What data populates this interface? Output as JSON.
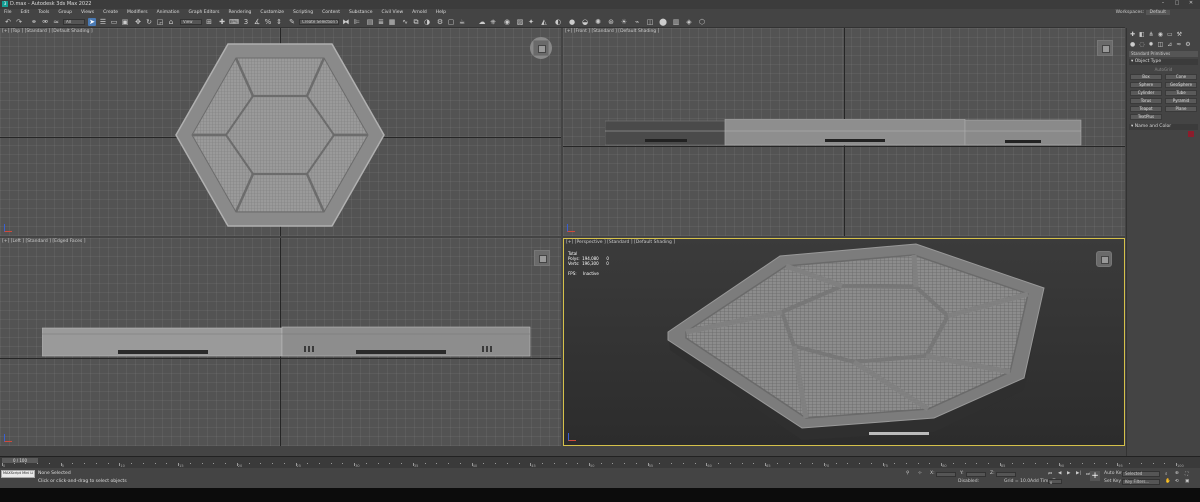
{
  "window": {
    "title": "D.max - Autodesk 3ds Max 2022",
    "controls": [
      "–",
      "□",
      "✕"
    ]
  },
  "menu": {
    "items": [
      "File",
      "Edit",
      "Tools",
      "Group",
      "Views",
      "Create",
      "Modifiers",
      "Animation",
      "Graph Editors",
      "Rendering",
      "Customize",
      "Scripting",
      "Content",
      "Substance",
      "Civil View",
      "Arnold",
      "Help"
    ],
    "workspace_label": "Workspaces:",
    "workspace_value": "Default"
  },
  "toolbar": {
    "filter": "All",
    "view": "View",
    "create_selection_set": "Create Selection Se"
  },
  "viewports": {
    "top": {
      "label": "[+] [Top ] [Standard ] [Default Shading ]"
    },
    "front": {
      "label": "[+] [Front ] [Standard ] [Default Shading ]"
    },
    "left": {
      "label": "[+] [Left ] [Standard ] [Edged Faces ]"
    },
    "perspective": {
      "label": "[+] [Perspective ] [Standard ] [Default Shading ]",
      "stats_total": "Total",
      "stats_polys": "Polys:  194,080      0",
      "stats_verts": "Verts:  196,300      0",
      "stats_fps": "FPS:     Inactive"
    }
  },
  "command_panel": {
    "category": "Standard Primitives",
    "object_type_title": "Object Type",
    "autogrid": "AutoGrid",
    "object_buttons": [
      "Box",
      "Cone",
      "Sphere",
      "GeoSphere",
      "Cylinder",
      "Tube",
      "Torus",
      "Pyramid",
      "Teapot",
      "Plane",
      "TextPlus"
    ],
    "name_color_title": "Name and Color"
  },
  "timeline": {
    "frame_display": "0 / 100",
    "tick_labels": [
      "0",
      "5",
      "10",
      "15",
      "20",
      "25",
      "30",
      "35",
      "40",
      "45",
      "50",
      "55",
      "60",
      "65",
      "70",
      "75",
      "80",
      "85",
      "90",
      "95",
      "100"
    ]
  },
  "status": {
    "maxscript_text": "MAXScript Mini Li",
    "selection": "None Selected",
    "prompt": "Click or click-and-drag to select objects",
    "x_label": "X:",
    "y_label": "Y:",
    "z_label": "Z:",
    "grid": "Grid = 10.0",
    "disabled": "Disabled:",
    "add_time_tag": "Add Time Tag",
    "auto_key": "Auto Key",
    "auto_key_value": "Selected",
    "set_key": "Set Key",
    "key_filters": "Key Filters...",
    "frame_value": "0"
  },
  "colors": {
    "accent_active_viewport": "#d5c14a",
    "object_color_swatch": "#8b1d2c",
    "toolbar_highlight": "#4a7ab4"
  }
}
